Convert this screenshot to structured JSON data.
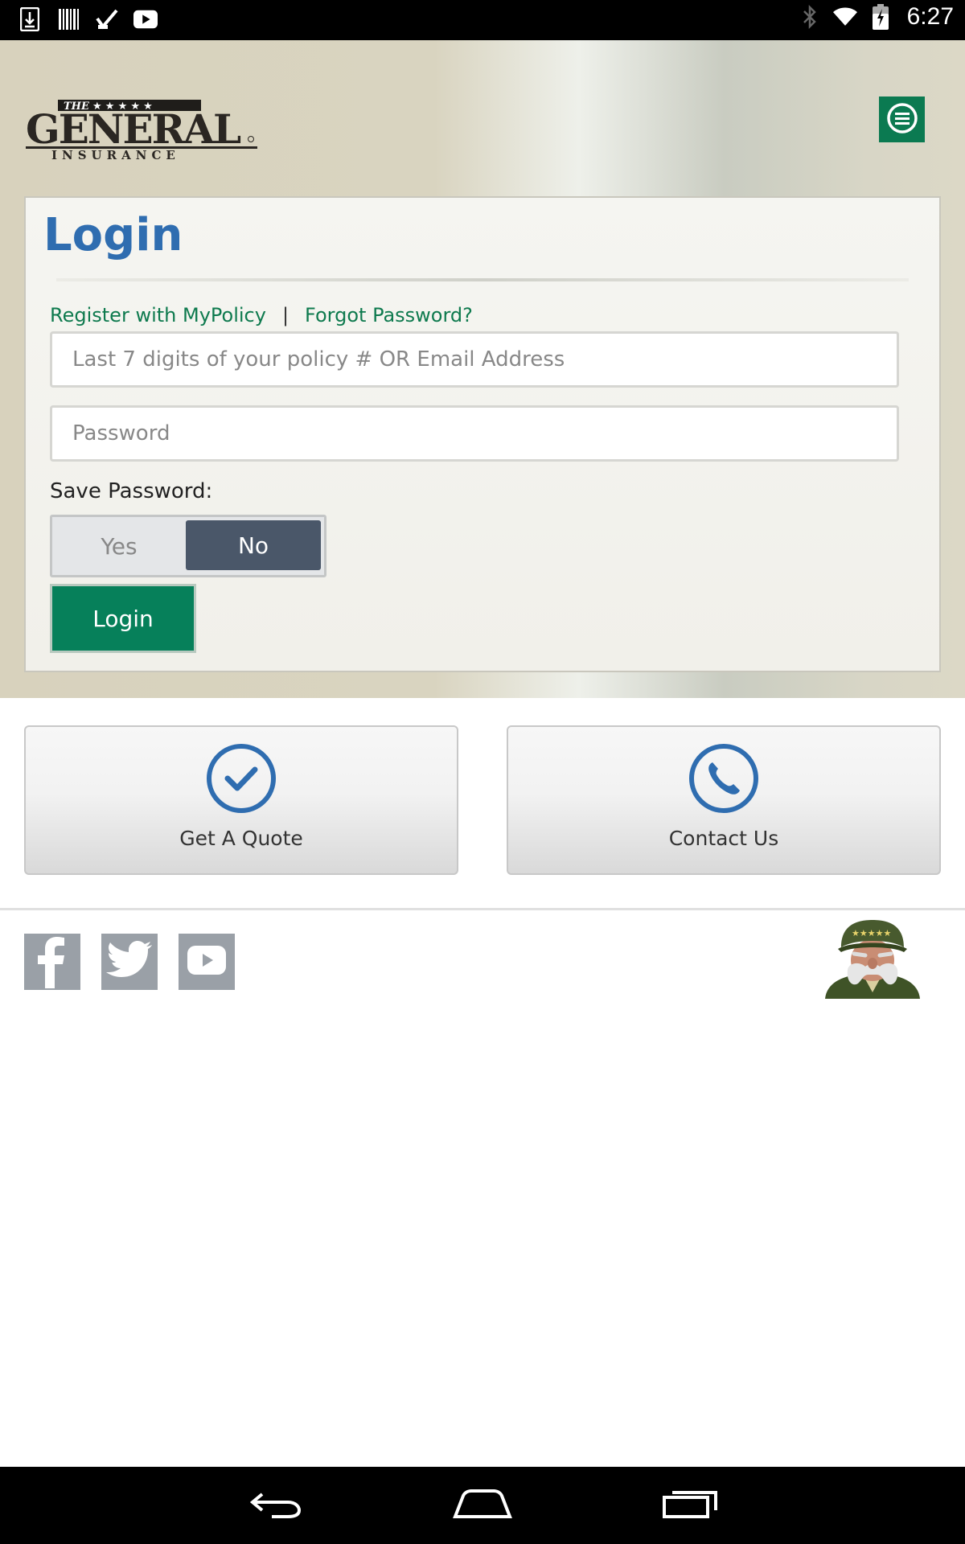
{
  "status_bar": {
    "time": "6:27",
    "left_icons": [
      "download-icon",
      "barcode-icon",
      "check-icon",
      "youtube-icon"
    ],
    "right_icons": [
      "bluetooth-icon",
      "wifi-icon",
      "battery-charging-icon"
    ]
  },
  "header": {
    "logo": "THE GENERAL INSURANCE",
    "menu_icon": "menu-icon"
  },
  "login": {
    "title": "Login",
    "register_link": "Register with MyPolicy",
    "separator": "|",
    "forgot_link": "Forgot Password?",
    "username_placeholder": "Last 7 digits of your policy # OR Email Address",
    "username_value": "",
    "password_placeholder": "Password",
    "password_value": "",
    "save_password_label": "Save Password:",
    "toggle_yes": "Yes",
    "toggle_no": "No",
    "toggle_selected": "No",
    "login_button": "Login"
  },
  "actions": {
    "quote_label": "Get A Quote",
    "quote_icon": "checkmark-circle-icon",
    "contact_label": "Contact Us",
    "contact_icon": "phone-circle-icon"
  },
  "social": [
    "facebook-icon",
    "twitter-icon",
    "youtube-icon"
  ],
  "colors": {
    "brand_green": "#06805a",
    "title_blue": "#2f6db0",
    "toggle_active": "#4a5769",
    "social_gray": "#9aa0a7"
  }
}
